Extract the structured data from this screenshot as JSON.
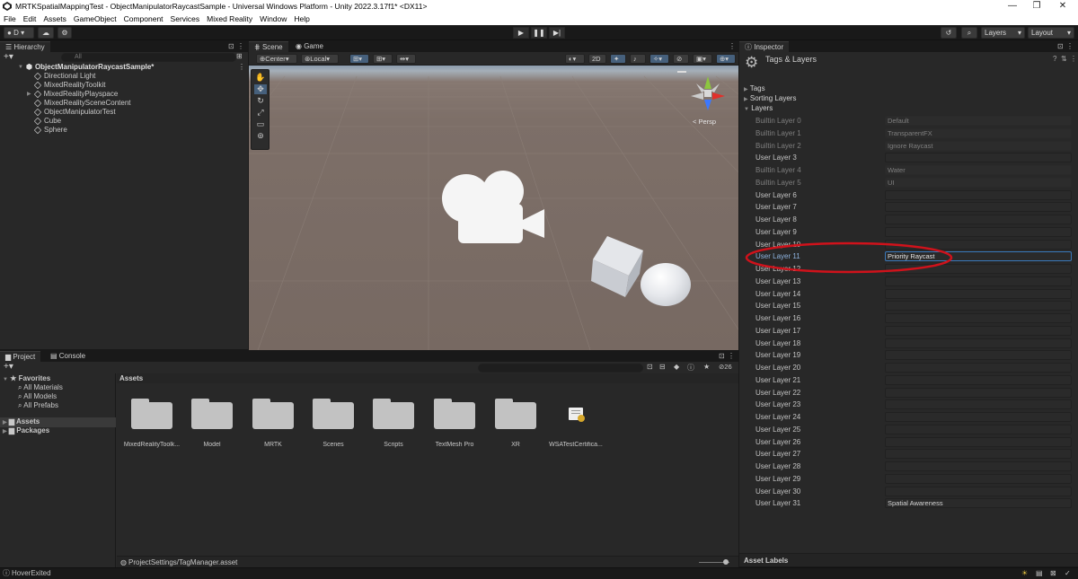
{
  "window": {
    "title": "MRTKSpatialMappingTest - ObjectManipulatorRaycastSample - Universal Windows Platform - Unity 2022.3.17f1* <DX11>",
    "minimize": "—",
    "maximize": "❐",
    "close": "✕"
  },
  "menu": [
    "File",
    "Edit",
    "Assets",
    "GameObject",
    "Component",
    "Services",
    "Mixed Reality",
    "Window",
    "Help"
  ],
  "toolbar": {
    "account": "D",
    "layers_label": "Layers",
    "layout_label": "Layout"
  },
  "hierarchy": {
    "tab": "Hierarchy",
    "search_placeholder": "All",
    "scene": "ObjectManipulatorRaycastSample*",
    "items": [
      "Directional Light",
      "MixedRealityToolkit",
      "MixedRealityPlayspace",
      "MixedRealitySceneContent",
      "ObjectManipulatorTest",
      "Cube",
      "Sphere"
    ]
  },
  "scene": {
    "tab_scene": "Scene",
    "tab_game": "Game",
    "pivot": "Center",
    "space": "Local",
    "mode_2d": "2D",
    "persp_label": "< Persp"
  },
  "inspector": {
    "tab": "Inspector",
    "title": "Tags & Layers",
    "sections": [
      "Tags",
      "Sorting Layers",
      "Layers"
    ],
    "layers": [
      {
        "label": "Builtin Layer 0",
        "value": "Default",
        "builtin": true
      },
      {
        "label": "Builtin Layer 1",
        "value": "TransparentFX",
        "builtin": true
      },
      {
        "label": "Builtin Layer 2",
        "value": "Ignore Raycast",
        "builtin": true
      },
      {
        "label": "User Layer 3",
        "value": "",
        "builtin": false
      },
      {
        "label": "Builtin Layer 4",
        "value": "Water",
        "builtin": true
      },
      {
        "label": "Builtin Layer 5",
        "value": "UI",
        "builtin": true
      },
      {
        "label": "User Layer 6",
        "value": "",
        "builtin": false
      },
      {
        "label": "User Layer 7",
        "value": "",
        "builtin": false
      },
      {
        "label": "User Layer 8",
        "value": "",
        "builtin": false
      },
      {
        "label": "User Layer 9",
        "value": "",
        "builtin": false
      },
      {
        "label": "User Layer 10",
        "value": "",
        "builtin": false
      },
      {
        "label": "User Layer 11",
        "value": "Priority Raycast",
        "builtin": false,
        "active": true
      },
      {
        "label": "User Layer 12",
        "value": "",
        "builtin": false
      },
      {
        "label": "User Layer 13",
        "value": "",
        "builtin": false
      },
      {
        "label": "User Layer 14",
        "value": "",
        "builtin": false
      },
      {
        "label": "User Layer 15",
        "value": "",
        "builtin": false
      },
      {
        "label": "User Layer 16",
        "value": "",
        "builtin": false
      },
      {
        "label": "User Layer 17",
        "value": "",
        "builtin": false
      },
      {
        "label": "User Layer 18",
        "value": "",
        "builtin": false
      },
      {
        "label": "User Layer 19",
        "value": "",
        "builtin": false
      },
      {
        "label": "User Layer 20",
        "value": "",
        "builtin": false
      },
      {
        "label": "User Layer 21",
        "value": "",
        "builtin": false
      },
      {
        "label": "User Layer 22",
        "value": "",
        "builtin": false
      },
      {
        "label": "User Layer 23",
        "value": "",
        "builtin": false
      },
      {
        "label": "User Layer 24",
        "value": "",
        "builtin": false
      },
      {
        "label": "User Layer 25",
        "value": "",
        "builtin": false
      },
      {
        "label": "User Layer 26",
        "value": "",
        "builtin": false
      },
      {
        "label": "User Layer 27",
        "value": "",
        "builtin": false
      },
      {
        "label": "User Layer 28",
        "value": "",
        "builtin": false
      },
      {
        "label": "User Layer 29",
        "value": "",
        "builtin": false
      },
      {
        "label": "User Layer 30",
        "value": "",
        "builtin": false
      },
      {
        "label": "User Layer 31",
        "value": "Spatial Awareness",
        "builtin": false
      }
    ],
    "asset_labels": "Asset Labels"
  },
  "project": {
    "tab_project": "Project",
    "tab_console": "Console",
    "favorites": "Favorites",
    "fav_items": [
      "All Materials",
      "All Models",
      "All Prefabs"
    ],
    "tree": [
      "Assets",
      "Packages"
    ],
    "breadcrumb": "Assets",
    "hidden_count": "26",
    "folders": [
      "MixedRealityToolk...",
      "Model",
      "MRTK",
      "Scenes",
      "Scripts",
      "TextMesh Pro",
      "XR"
    ],
    "file": "WSATestCertifica...",
    "selected_path": "ProjectSettings/TagManager.asset"
  },
  "status": {
    "message": "HoverExited"
  },
  "colors": {
    "accent": "#3a79bb",
    "annotation": "#d0121b"
  }
}
